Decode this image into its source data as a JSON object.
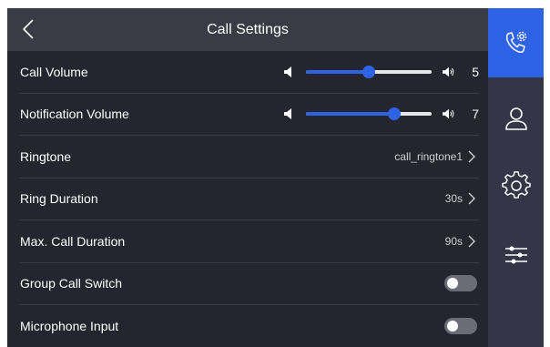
{
  "header": {
    "title": "Call Settings",
    "back_icon": "chevron-left-icon"
  },
  "rows": {
    "call_volume": {
      "label": "Call Volume",
      "value": "5",
      "level": 0.5
    },
    "notification_volume": {
      "label": "Notification Volume",
      "value": "7",
      "level": 0.7
    },
    "ringtone": {
      "label": "Ringtone",
      "value": "call_ringtone1"
    },
    "ring_duration": {
      "label": "Ring Duration",
      "value": "30s"
    },
    "max_call_duration": {
      "label": "Max. Call Duration",
      "value": "90s"
    },
    "group_call_switch": {
      "label": "Group Call Switch",
      "on": false
    },
    "microphone_input": {
      "label": "Microphone Input",
      "on": false
    }
  },
  "sidebar": {
    "items": [
      {
        "icon": "phone-settings-icon",
        "active": true
      },
      {
        "icon": "user-icon",
        "active": false
      },
      {
        "icon": "gear-icon",
        "active": false
      },
      {
        "icon": "sliders-icon",
        "active": false
      }
    ]
  },
  "colors": {
    "accent": "#2e63e6",
    "background": "#24252e",
    "header": "#3a3b45",
    "sidebar": "#353547"
  }
}
